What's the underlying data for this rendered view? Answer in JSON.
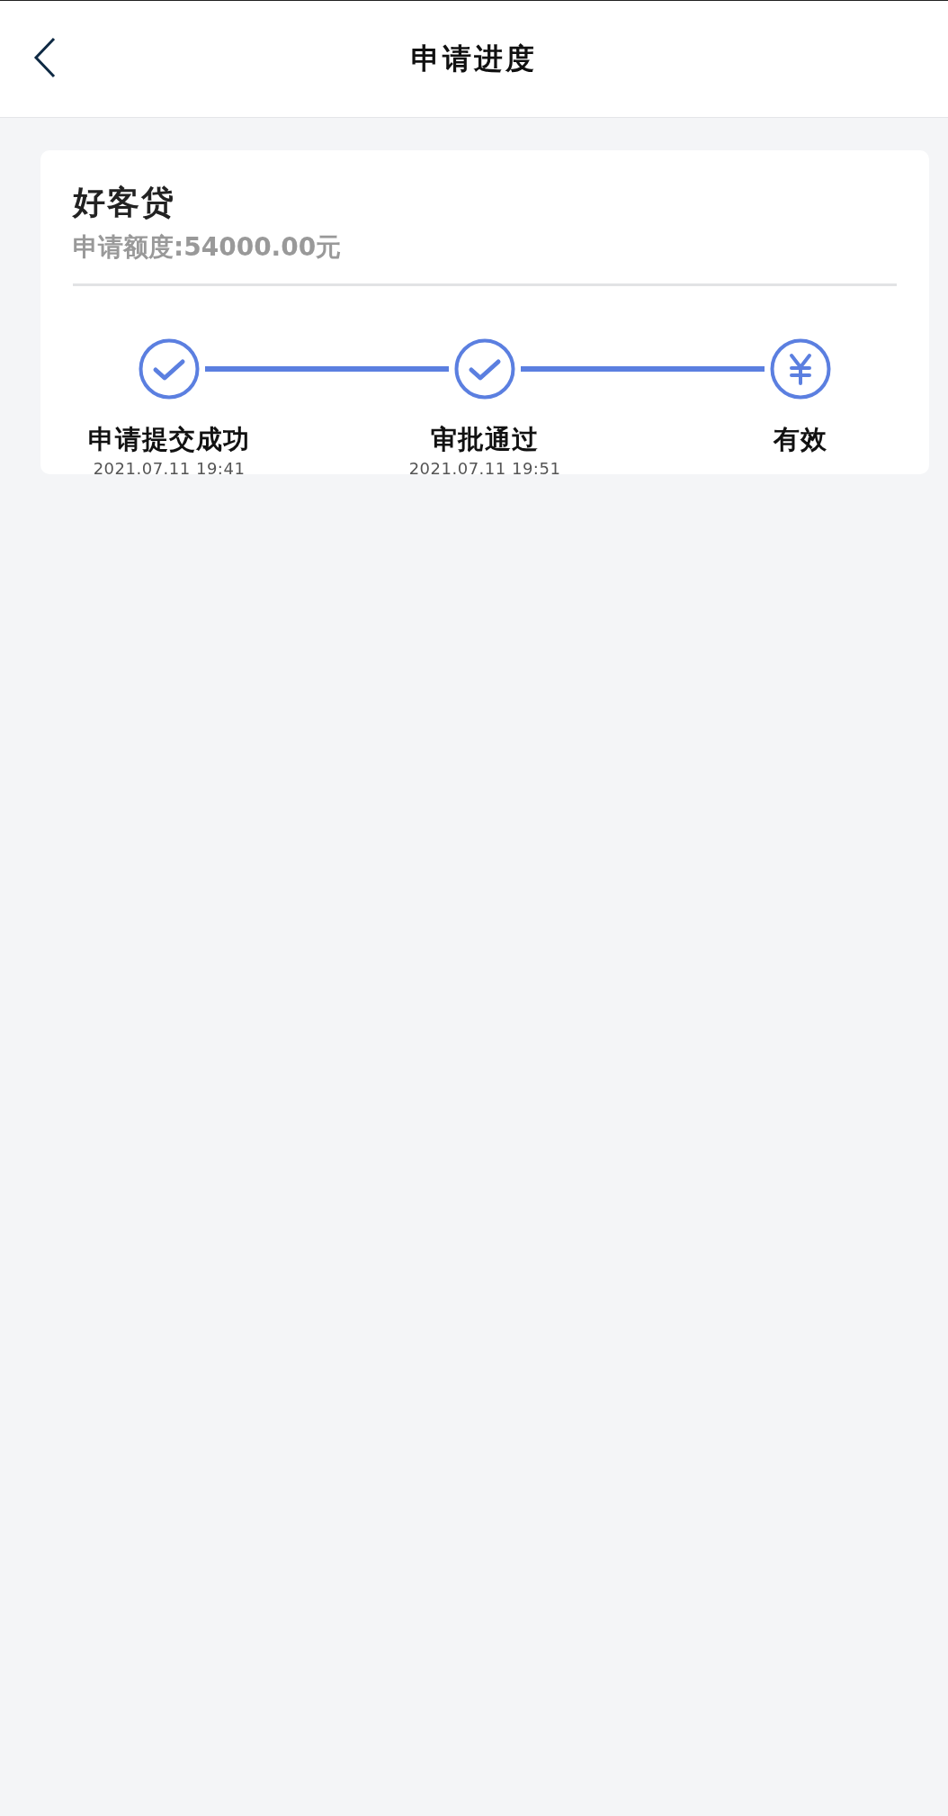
{
  "header": {
    "title": "申请进度"
  },
  "loan": {
    "name": "好客贷",
    "amount": "申请额度:54000.00元"
  },
  "steps": [
    {
      "kind": "check",
      "label": "申请提交成功",
      "time": "2021.07.11 19:41"
    },
    {
      "kind": "check",
      "label": "审批通过",
      "time": "2021.07.11 19:51"
    },
    {
      "kind": "yen",
      "label": "有效"
    }
  ]
}
